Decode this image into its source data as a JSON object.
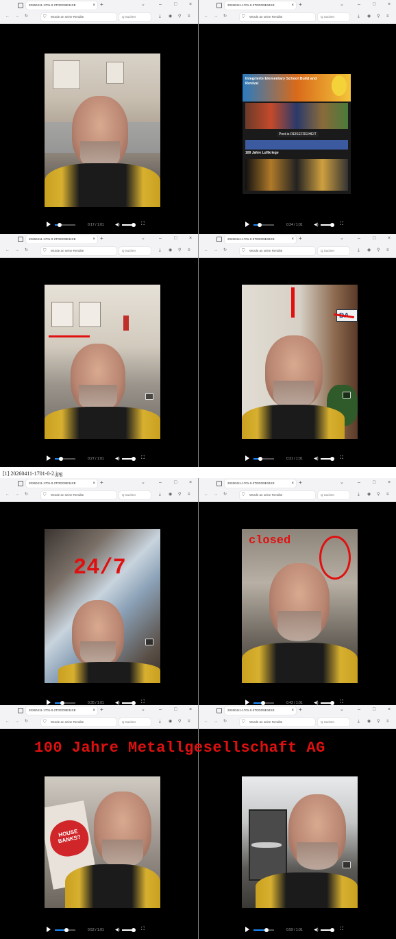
{
  "caption": "[1] 20260411-1701-0-2.jpg",
  "overlay_title": "100 Jahre Metallgesellschaft AG",
  "panels": [
    {
      "tab": "20260411-1701-0-2TODO9E34XE",
      "url": "Würde an seine Rendite",
      "search": "Q Suchen",
      "time": "0:17 / 1:01",
      "progress": 0.17
    },
    {
      "tab": "20260411-1701-0-2TODO9E34XE",
      "url": "Würde an seine Rendite",
      "search": "Q Suchen",
      "time": "0:24 / 1:01",
      "progress": 0.24,
      "slide": {
        "heading": "Integrierte Elementary School Build and Revival",
        "banner": "Post-is-REISEFREIHEIT",
        "sub": "100 Jahre Luftkriege"
      }
    },
    {
      "tab": "20260411-1701-0-2TODO9E34XE",
      "url": "Würde an seine Rendite",
      "search": "Q Suchen",
      "time": "0:27 / 1:01",
      "progress": 0.27
    },
    {
      "tab": "20260411-1701-0-2TODO9E34XE",
      "url": "Würde an seine Rendite",
      "search": "Q Suchen",
      "time": "0:31 / 1:01",
      "progress": 0.31,
      "sign": "DA"
    },
    {
      "tab": "20260411-1701-0-2TODO9E34XE",
      "url": "Würde an seine Rendite",
      "search": "Q Suchen",
      "time": "0:35 / 1:01",
      "progress": 0.35,
      "overlay": "24/7"
    },
    {
      "tab": "20260411-1701-0-2TODO9E34XE",
      "url": "Würde an seine Rendite",
      "search": "Q Suchen",
      "time": "0:42 / 1:01",
      "progress": 0.42,
      "overlay": "closed"
    },
    {
      "tab": "20260411-1701-0-2TODO9E34XE",
      "url": "Würde an seine Rendite",
      "search": "Q Suchen",
      "time": "0:52 / 1:01",
      "progress": 0.52,
      "poster": "HOUSE BANKS?"
    },
    {
      "tab": "20260411-1701-0-2TODO9E34XE",
      "url": "Würde an seine Rendite",
      "search": "Q Suchen",
      "time": "0:59 / 1:01",
      "progress": 0.59
    }
  ],
  "icons": {
    "play": "play-icon",
    "volume": "volume-icon",
    "fullscreen": "fullscreen-icon",
    "pip": "picture-in-picture-icon"
  },
  "colors": {
    "annotation": "#e01010",
    "seek": "#1a8cff",
    "jacket": "#d8b030"
  }
}
